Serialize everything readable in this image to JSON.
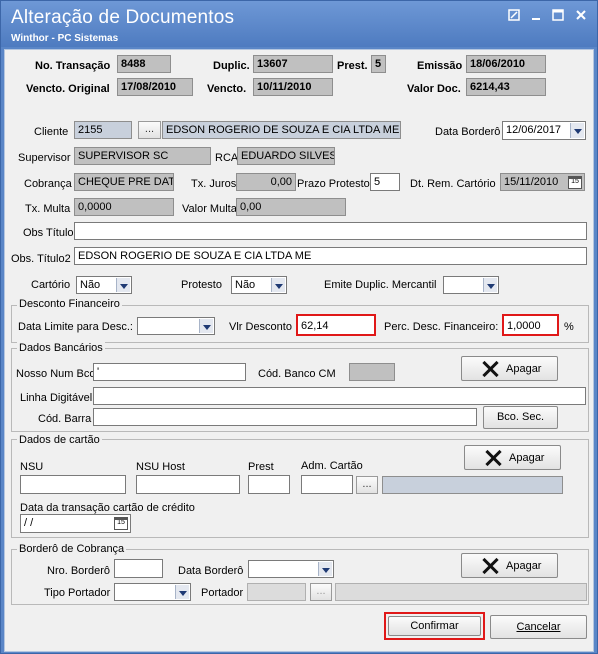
{
  "window": {
    "title": "Alteração de Documentos",
    "subtitle": "Winthor - PC Sistemas"
  },
  "header": {
    "no_transacao_label": "No. Transação",
    "no_transacao": "8488",
    "duplic_label": "Duplic.",
    "duplic": "13607",
    "prest_label": "Prest.",
    "prest": "5",
    "emissao_label": "Emissão",
    "emissao": "18/06/2010",
    "vencto_original_label": "Vencto. Original",
    "vencto_original": "17/08/2010",
    "vencto_label": "Vencto.",
    "vencto": "10/11/2010",
    "valor_doc_label": "Valor Doc.",
    "valor_doc": "6214,43"
  },
  "form": {
    "cliente_label": "Cliente",
    "cliente_code": "2155",
    "cliente_name": "EDSON ROGERIO DE SOUZA E CIA LTDA ME",
    "data_bordero_label": "Data Borderô",
    "data_bordero": "12/06/2017",
    "supervisor_label": "Supervisor",
    "supervisor": "SUPERVISOR SC",
    "rca_label": "RCA",
    "rca": "EDUARDO SILVESTI",
    "cobranca_label": "Cobrança",
    "cobranca": "CHEQUE PRE DATAD",
    "tx_juros_label": "Tx. Juros",
    "tx_juros": "0,00",
    "prazo_protesto_label": "Prazo Protesto",
    "prazo_protesto": "5",
    "dt_rem_cartorio_label": "Dt. Rem. Cartório",
    "dt_rem_cartorio": "15/11/2010",
    "tx_multa_label": "Tx. Multa",
    "tx_multa": "0,0000",
    "valor_multa_label": "Valor Multa",
    "valor_multa": "0,00",
    "obs_titulo_label": "Obs Título",
    "obs_titulo": "",
    "obs_titulo2_label": "Obs. Título2",
    "obs_titulo2": "EDSON ROGERIO DE SOUZA E CIA LTDA ME",
    "cartorio_label": "Cartório",
    "cartorio": "Não",
    "protesto_label": "Protesto",
    "protesto": "Não",
    "emite_duplic_label": "Emite Duplic. Mercantil",
    "emite_duplic": ""
  },
  "desconto": {
    "title": "Desconto Financeiro",
    "data_limite_label": "Data Limite para Desc.:",
    "data_limite": "",
    "vlr_desconto_label": "Vlr Desconto",
    "vlr_desconto": "62,14",
    "perc_label": "Perc. Desc. Financeiro:",
    "perc": "1,0000",
    "perc_unit": "%"
  },
  "bancarios": {
    "title": "Dados Bancários",
    "nosso_num_label": "Nosso Num Bco",
    "nosso_num": "'",
    "cod_banco_label": "Cód. Banco CM",
    "apagar": "Apagar",
    "linha_digitavel_label": "Linha Digitável",
    "cod_barra_label": "Cód. Barra",
    "bco_sec": "Bco. Sec."
  },
  "cartao": {
    "title": "Dados de cartão",
    "nsu_label": "NSU",
    "nsu_host_label": "NSU Host",
    "prest_label": "Prest",
    "adm_cartao_label": "Adm. Cartão",
    "apagar": "Apagar",
    "data_transacao_label": "Data da transação cartão de crédito",
    "data_transacao": " /  /"
  },
  "bordero": {
    "title": "Borderô de Cobrança",
    "nro_label": "Nro. Borderô",
    "data_label": "Data Borderô",
    "tipo_portador_label": "Tipo Portador",
    "portador_label": "Portador",
    "apagar": "Apagar"
  },
  "footer": {
    "confirmar": "Confirmar",
    "cancelar": "Cancelar"
  },
  "ellipsis": "...",
  "calendar_glyph": "15",
  "colors": {
    "title_bar": "#5a86c7",
    "highlight": "#e01818",
    "readonly": "#c0c0c0"
  }
}
